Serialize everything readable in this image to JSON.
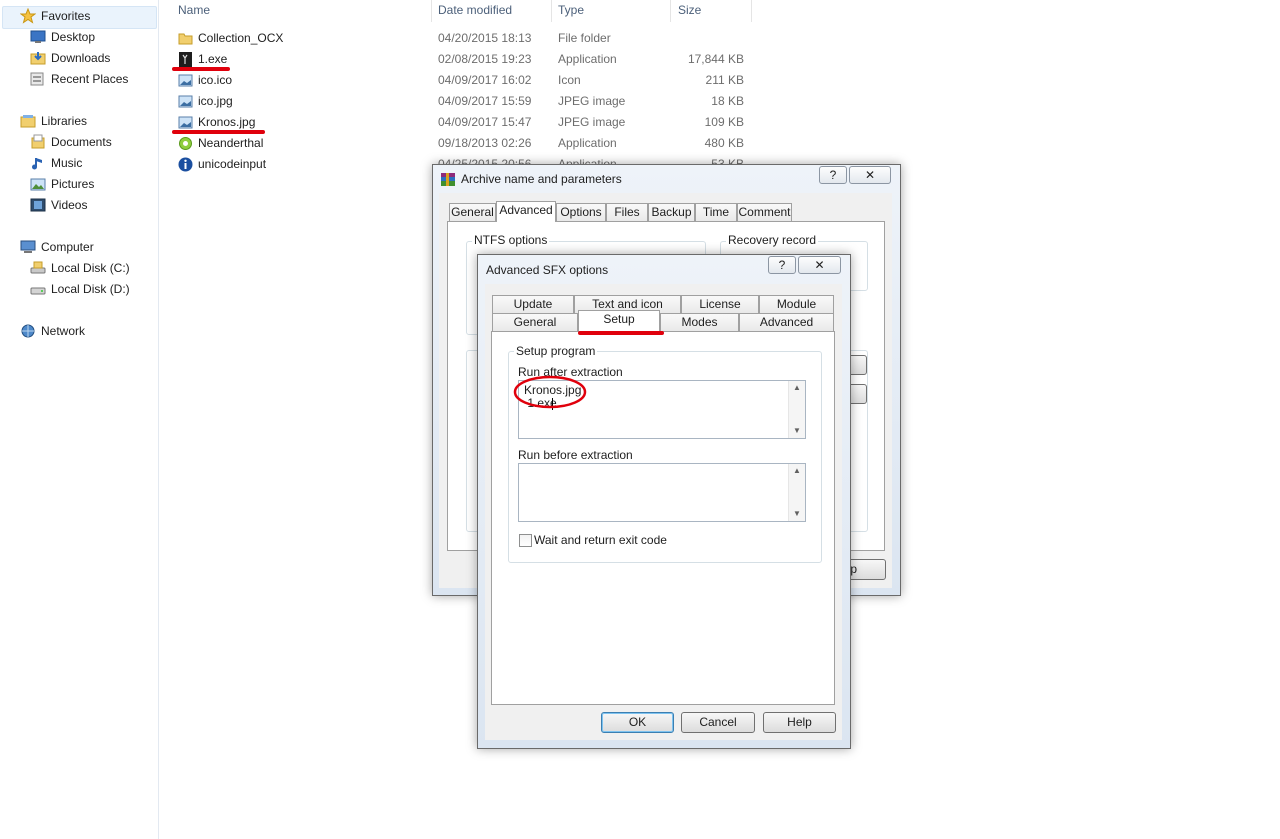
{
  "nav": {
    "favorites": "Favorites",
    "desktop": "Desktop",
    "downloads": "Downloads",
    "recent_places": "Recent Places",
    "libraries": "Libraries",
    "documents": "Documents",
    "music": "Music",
    "pictures": "Pictures",
    "videos": "Videos",
    "computer": "Computer",
    "local_c": "Local Disk (C:)",
    "local_d": "Local Disk (D:)",
    "network": "Network"
  },
  "columns": {
    "name": "Name",
    "date": "Date modified",
    "type": "Type",
    "size": "Size"
  },
  "files": [
    {
      "name": "Collection_OCX",
      "date": "04/20/2015 18:13",
      "type": "File folder",
      "size": ""
    },
    {
      "name": "1.exe",
      "date": "02/08/2015 19:23",
      "type": "Application",
      "size": "17,844 KB"
    },
    {
      "name": "ico.ico",
      "date": "04/09/2017 16:02",
      "type": "Icon",
      "size": "211 KB"
    },
    {
      "name": "ico.jpg",
      "date": "04/09/2017 15:59",
      "type": "JPEG image",
      "size": "18 KB"
    },
    {
      "name": "Kronos.jpg",
      "date": "04/09/2017 15:47",
      "type": "JPEG image",
      "size": "109 KB"
    },
    {
      "name": "Neanderthal",
      "date": "09/18/2013 02:26",
      "type": "Application",
      "size": "480 KB"
    },
    {
      "name": "unicodeinput",
      "date": "04/25/2015 20:56",
      "type": "Application",
      "size": "53 KB"
    }
  ],
  "archive_dialog": {
    "title": "Archive name and parameters",
    "help_btn": "?",
    "close_btn": "✕",
    "tabs": [
      "General",
      "Advanced",
      "Options",
      "Files",
      "Backup",
      "Time",
      "Comment"
    ],
    "ntfs_options": "NTFS options",
    "recovery_record": "Recovery record",
    "help_fragment": "lp"
  },
  "sfx_dialog": {
    "title": "Advanced SFX options",
    "help_btn": "?",
    "close_btn": "✕",
    "tabs_row1": [
      "Update",
      "Text and icon",
      "License",
      "Module"
    ],
    "tabs_row2": [
      "General",
      "Setup",
      "Modes",
      "Advanced"
    ],
    "setup_program": "Setup program",
    "run_after_label": "Run after extraction",
    "run_after_value": "Kronos.jpg\n 1.exe",
    "run_before_label": "Run before extraction",
    "run_before_value": "",
    "wait_label": "Wait and return exit code",
    "wait_checked": false,
    "ok": "OK",
    "cancel": "Cancel",
    "help": "Help"
  },
  "colors": {
    "highlight_red": "#e0000c",
    "selection_blue": "#eaf3fc"
  }
}
